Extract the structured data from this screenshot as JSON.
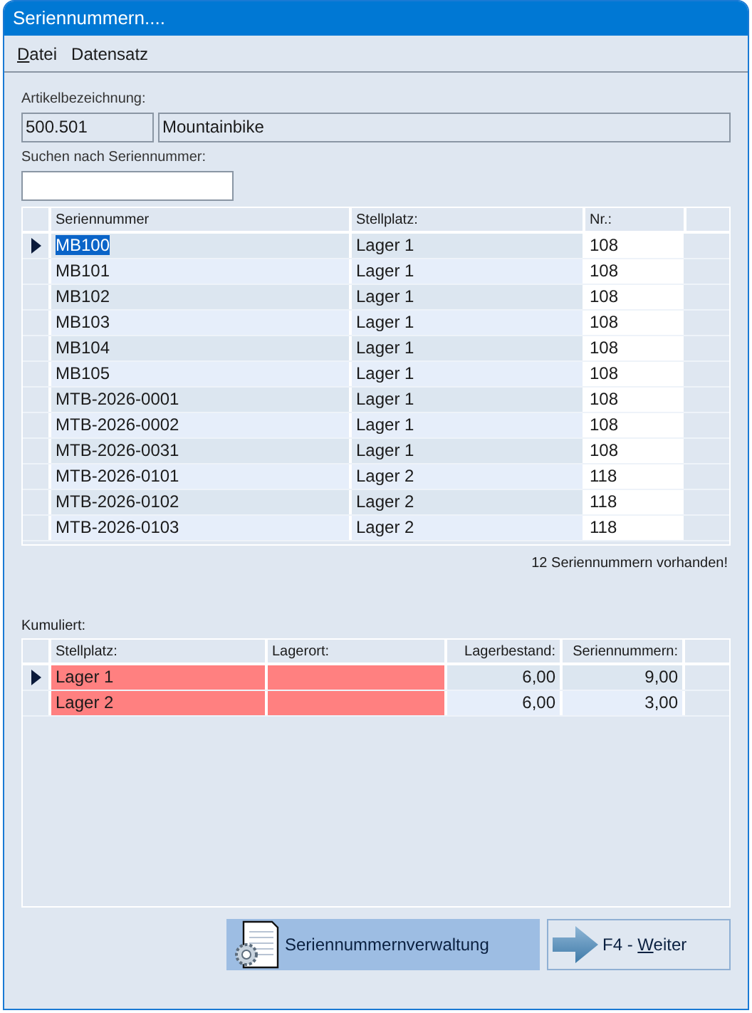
{
  "window": {
    "title": "Seriennummern...."
  },
  "menu": [
    {
      "label": "Datei",
      "mnemonic_underlined": true
    },
    {
      "label": "Datensatz"
    }
  ],
  "article": {
    "label": "Artikelbezeichnung:",
    "number": "500.501",
    "name": "Mountainbike"
  },
  "search": {
    "label": "Suchen nach Seriennummer:"
  },
  "serials": {
    "columns": [
      "Seriennummer",
      "Stellplatz:",
      "Nr.:"
    ],
    "rows": [
      {
        "serial": "MB100",
        "location": "Lager 1",
        "nr": "108",
        "selected": true
      },
      {
        "serial": "MB101",
        "location": "Lager 1",
        "nr": "108",
        "selected": false
      },
      {
        "serial": "MB102",
        "location": "Lager 1",
        "nr": "108",
        "selected": false
      },
      {
        "serial": "MB103",
        "location": "Lager 1",
        "nr": "108",
        "selected": false
      },
      {
        "serial": "MB104",
        "location": "Lager 1",
        "nr": "108",
        "selected": false
      },
      {
        "serial": "MB105",
        "location": "Lager 1",
        "nr": "108",
        "selected": false
      },
      {
        "serial": "MTB-2026-0001",
        "location": "Lager 1",
        "nr": "108",
        "selected": false
      },
      {
        "serial": "MTB-2026-0002",
        "location": "Lager 1",
        "nr": "108",
        "selected": false
      },
      {
        "serial": "MTB-2026-0031",
        "location": "Lager 1",
        "nr": "108",
        "selected": false
      },
      {
        "serial": "MTB-2026-0101",
        "location": "Lager 2",
        "nr": "118",
        "selected": false
      },
      {
        "serial": "MTB-2026-0102",
        "location": "Lager 2",
        "nr": "118",
        "selected": false
      },
      {
        "serial": "MTB-2026-0103",
        "location": "Lager 2",
        "nr": "118",
        "selected": false
      }
    ],
    "count_text": "12 Seriennummern vorhanden!"
  },
  "cumulative": {
    "label": "Kumuliert:",
    "columns": [
      "Stellplatz:",
      "Lagerort:",
      "Lagerbestand:",
      "Seriennummern:"
    ],
    "rows": [
      {
        "location": "Lager 1",
        "stock": "6,00",
        "serials": "9,00",
        "selected": true,
        "flagged": true
      },
      {
        "location": "Lager 2",
        "stock": "6,00",
        "serials": "3,00",
        "selected": false,
        "flagged": true
      }
    ]
  },
  "buttons": [
    {
      "kind": "manage",
      "label": "Seriennummernverwaltung"
    },
    {
      "kind": "next",
      "label": "F4 - Weiter",
      "mnemonic_underlined": true
    }
  ]
}
